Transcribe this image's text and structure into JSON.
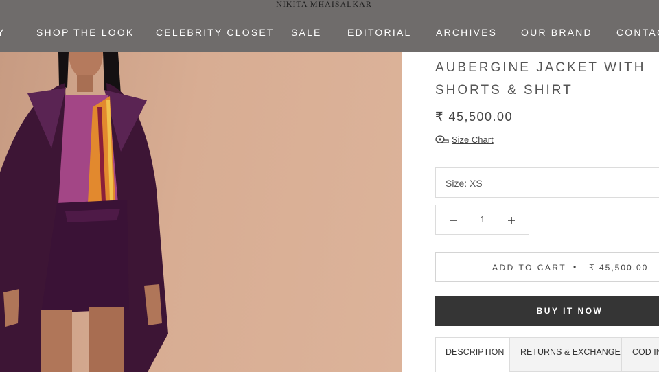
{
  "header": {
    "brand": "NIKITA MHAISALKAR",
    "nav": [
      "Y",
      "SHOP THE LOOK",
      "CELEBRITY CLOSET",
      "SALE",
      "EDITORIAL",
      "ARCHIVES",
      "OUR BRAND",
      "CONTAC"
    ]
  },
  "product": {
    "title_line1": "AUBERGINE JACKET WITH",
    "title_line2": "SHORTS & SHIRT",
    "price": "₹ 45,500.00",
    "size_chart_label": "Size Chart",
    "size_label": "Size: XS",
    "quantity": "1",
    "add_to_cart_label": "ADD TO CART",
    "add_to_cart_separator": "•",
    "add_to_cart_price": "₹ 45,500.00",
    "buy_now_label": "BUY IT NOW"
  },
  "tabs": [
    "DESCRIPTION",
    "RETURNS & EXCHANGE",
    "COD IN"
  ],
  "colors": {
    "header_bg": "#6f6c6b",
    "buy_button_bg": "#353535",
    "photo_bg": "#d8ad93",
    "garment": "#4a1b3e"
  },
  "icons": [
    "tape-measure-icon",
    "minus-icon",
    "plus-icon"
  ]
}
